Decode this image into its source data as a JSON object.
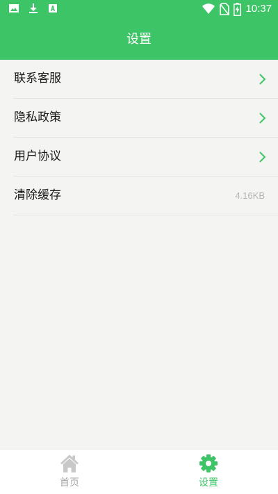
{
  "colors": {
    "accent": "#3dc466",
    "background": "#f4f4f2",
    "chevron": "#3dc466",
    "inactive": "#a6a6a6"
  },
  "status_bar": {
    "time": "10:37",
    "icons": [
      "image-icon",
      "download-icon",
      "text-a-icon",
      "wifi-icon",
      "no-sim-icon",
      "battery-charging-icon"
    ]
  },
  "header": {
    "title": "设置"
  },
  "settings": {
    "items": [
      {
        "label": "联系客服",
        "icon": "chevron-right-icon"
      },
      {
        "label": "隐私政策",
        "icon": "chevron-right-icon"
      },
      {
        "label": "用户协议",
        "icon": "chevron-right-icon"
      },
      {
        "label": "清除缓存",
        "value": "4.16KB"
      }
    ]
  },
  "bottom_nav": {
    "items": [
      {
        "label": "首页",
        "icon": "home-icon",
        "active": false
      },
      {
        "label": "设置",
        "icon": "gear-icon",
        "active": true
      }
    ]
  }
}
